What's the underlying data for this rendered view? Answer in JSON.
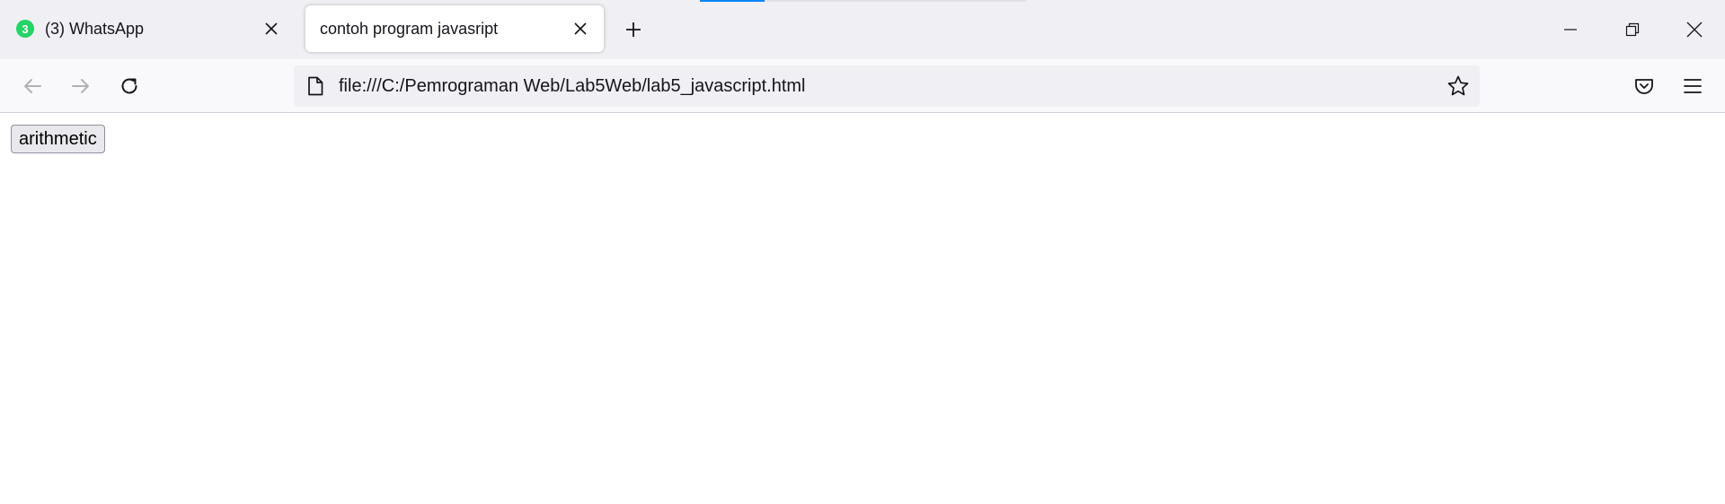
{
  "tabs": [
    {
      "badge": "3",
      "title": "(3) WhatsApp",
      "active": false
    },
    {
      "title": "contoh program javasript",
      "active": true
    }
  ],
  "icons": {
    "tab_close": "close-icon",
    "new_tab": "plus-icon",
    "minimize": "minimize-icon",
    "restore": "restore-icon",
    "close_window": "close-icon",
    "back": "back-arrow-icon",
    "forward": "forward-arrow-icon",
    "reload": "reload-icon",
    "page": "page-icon",
    "bookmark": "star-icon",
    "pocket": "pocket-icon",
    "menu": "hamburger-menu-icon"
  },
  "urlbar": {
    "url": "file:///C:/Pemrograman Web/Lab5Web/lab5_javascript.html"
  },
  "page": {
    "button_label": "arithmetic"
  },
  "colors": {
    "accent": "#0a84ff",
    "whatsapp_green": "#25d366"
  }
}
